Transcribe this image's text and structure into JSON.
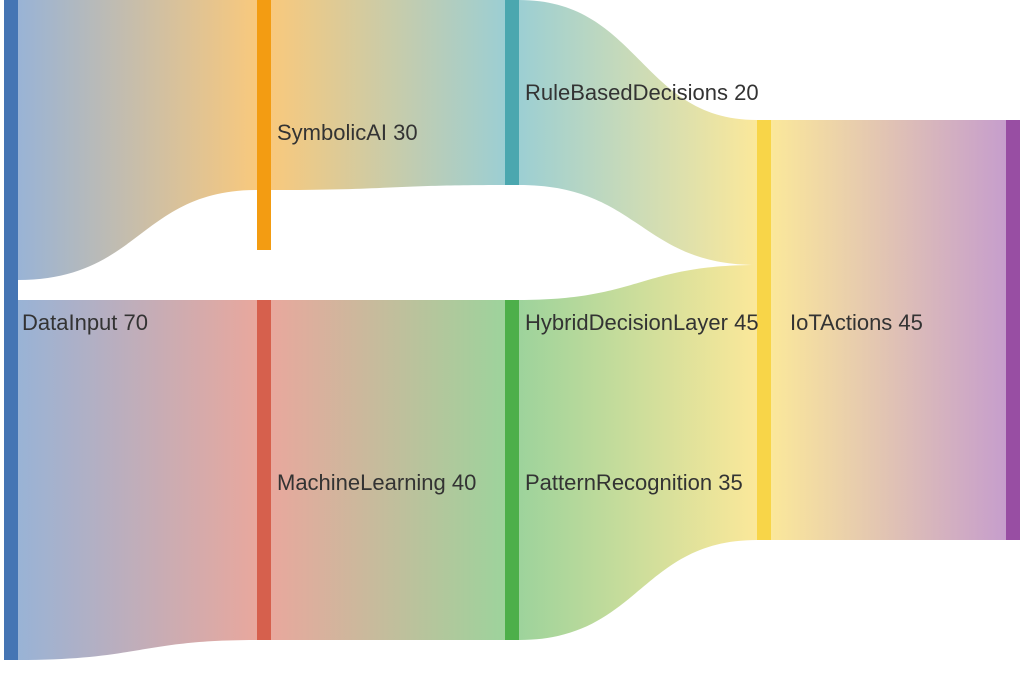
{
  "chart_data": {
    "type": "sankey",
    "nodes": [
      {
        "id": "DataInput",
        "label": "DataInput",
        "value": 70,
        "color": "#4575b4"
      },
      {
        "id": "SymbolicAI",
        "label": "SymbolicAI",
        "value": 30,
        "color": "#f39c12"
      },
      {
        "id": "MachineLearning",
        "label": "MachineLearning",
        "value": 40,
        "color": "#d6604d"
      },
      {
        "id": "RuleBasedDecisions",
        "label": "RuleBasedDecisions",
        "value": 20,
        "color": "#4ba7af"
      },
      {
        "id": "HybridDecisionLayer",
        "label": "HybridDecisionLayer",
        "value": 45,
        "color": "#4daf4a"
      },
      {
        "id": "PatternRecognition",
        "label": "PatternRecognition",
        "value": 35,
        "color": "#4daf4a"
      },
      {
        "id": "IoTActions",
        "label": "IoTActions",
        "value": 45,
        "color": "#984ea3"
      }
    ],
    "links": [
      {
        "source": "DataInput",
        "target": "SymbolicAI",
        "value": 30
      },
      {
        "source": "DataInput",
        "target": "MachineLearning",
        "value": 40
      },
      {
        "source": "SymbolicAI",
        "target": "RuleBasedDecisions",
        "value": 20
      },
      {
        "source": "SymbolicAI",
        "target": "HybridDecisionLayer",
        "value": 10
      },
      {
        "source": "MachineLearning",
        "target": "HybridDecisionLayer",
        "value": 35
      },
      {
        "source": "MachineLearning",
        "target": "PatternRecognition",
        "value": 5
      },
      {
        "source": "RuleBasedDecisions",
        "target": "IoTActions",
        "value": 20
      },
      {
        "source": "HybridDecisionLayer",
        "target": "IoTActions",
        "value": 25
      },
      {
        "source": "PatternRecognition",
        "target": "IoTActions",
        "value": 0
      }
    ],
    "intermediate_color": "#f8d548"
  },
  "labels": {
    "DataInput": "DataInput 70",
    "SymbolicAI": "SymbolicAI 30",
    "MachineLearning": "MachineLearning 40",
    "RuleBasedDecisions": "RuleBasedDecisions 20",
    "HybridDecisionLayer": "HybridDecisionLayer 45",
    "PatternRecognition": "PatternRecognition 35",
    "IoTActions": "IoTActions 45"
  }
}
